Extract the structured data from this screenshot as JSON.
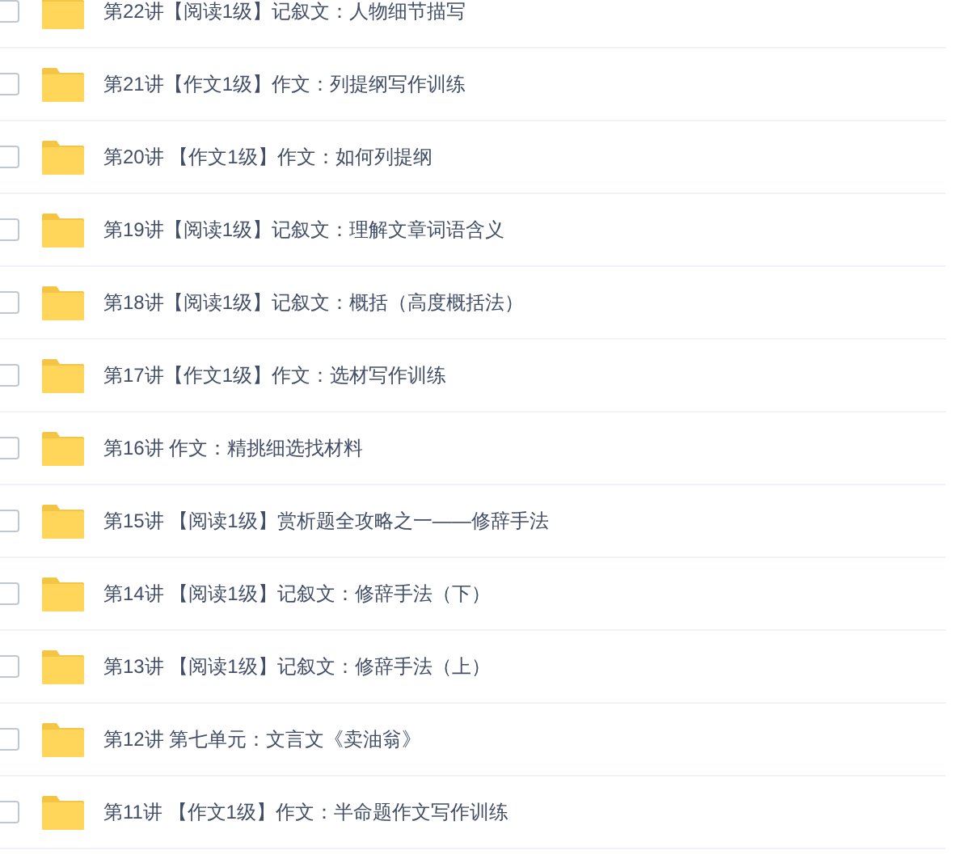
{
  "items": [
    {
      "name": "第22讲【阅读1级】记叙文：人物细节描写",
      "checked": false
    },
    {
      "name": "第21讲【作文1级】作文：列提纲写作训练",
      "checked": false
    },
    {
      "name": "第20讲 【作文1级】作文：如何列提纲",
      "checked": false
    },
    {
      "name": "第19讲【阅读1级】记叙文：理解文章词语含义",
      "checked": false
    },
    {
      "name": "第18讲【阅读1级】记叙文：概括（高度概括法）",
      "checked": false
    },
    {
      "name": "第17讲【作文1级】作文：选材写作训练",
      "checked": false
    },
    {
      "name": "第16讲 作文：精挑细选找材料",
      "checked": false
    },
    {
      "name": "第15讲 【阅读1级】赏析题全攻略之一——修辞手法",
      "checked": false
    },
    {
      "name": "第14讲 【阅读1级】记叙文：修辞手法（下）",
      "checked": false
    },
    {
      "name": "第13讲 【阅读1级】记叙文：修辞手法（上）",
      "checked": false
    },
    {
      "name": "第12讲 第七单元：文言文《卖油翁》",
      "checked": false
    },
    {
      "name": "第11讲 【作文1级】作文：半命题作文写作训练",
      "checked": false
    }
  ]
}
